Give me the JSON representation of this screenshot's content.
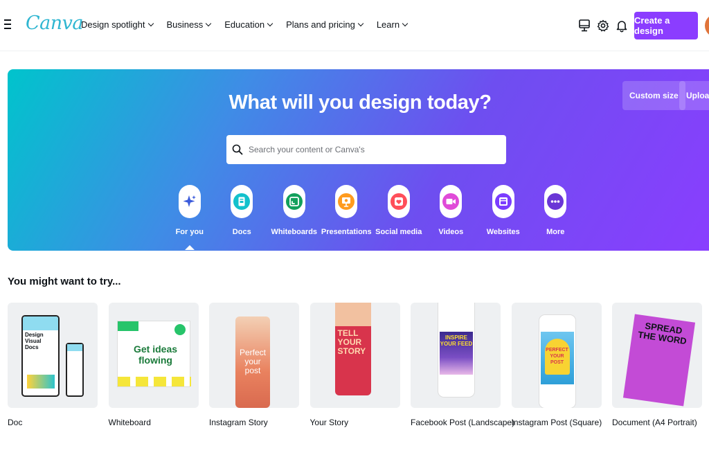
{
  "header": {
    "logo": "Canva",
    "nav": [
      {
        "label": "Design spotlight"
      },
      {
        "label": "Business"
      },
      {
        "label": "Education"
      },
      {
        "label": "Plans and pricing"
      },
      {
        "label": "Learn"
      }
    ],
    "icons": [
      "monitor-icon",
      "gear-icon",
      "bell-icon"
    ],
    "create_label": "Create a design"
  },
  "hero": {
    "title": "What will you design today?",
    "search_placeholder": "Search your content or Canva's",
    "custom_size_label": "Custom size",
    "upload_label": "Upload",
    "categories": [
      {
        "label": "For you",
        "icon": "sparkle-icon",
        "color": "#3b5bdb"
      },
      {
        "label": "Docs",
        "icon": "doc-icon",
        "color": "#13c1cc"
      },
      {
        "label": "Whiteboards",
        "icon": "whiteboard-icon",
        "color": "#12a05c"
      },
      {
        "label": "Presentations",
        "icon": "presentation-icon",
        "color": "#ff9b1e"
      },
      {
        "label": "Social media",
        "icon": "heart-icon",
        "color": "#ff4f5a"
      },
      {
        "label": "Videos",
        "icon": "video-icon",
        "color": "#e04bd8"
      },
      {
        "label": "Websites",
        "icon": "website-icon",
        "color": "#7a3cff"
      },
      {
        "label": "More",
        "icon": "more-icon",
        "color": "#6a36d6"
      }
    ]
  },
  "suggestions": {
    "title": "You might want to try...",
    "items": [
      {
        "label": "Doc",
        "image_text": "Design Visual Docs"
      },
      {
        "label": "Whiteboard",
        "image_text": "Get ideas flowing"
      },
      {
        "label": "Instagram Story",
        "image_text": "Perfect your post"
      },
      {
        "label": "Your Story",
        "image_text": "TELL YOUR STORY"
      },
      {
        "label": "Facebook Post (Landscape)",
        "image_text": "INSPIRE YOUR FEED"
      },
      {
        "label": "Instagram Post (Square)",
        "image_text": "PERFECT YOUR POST"
      },
      {
        "label": "Document (A4 Portrait)",
        "image_text": "SPREAD THE WORD"
      }
    ]
  },
  "colors": {
    "brand_purple": "#8b3dff",
    "brand_teal": "#00c4cc"
  }
}
